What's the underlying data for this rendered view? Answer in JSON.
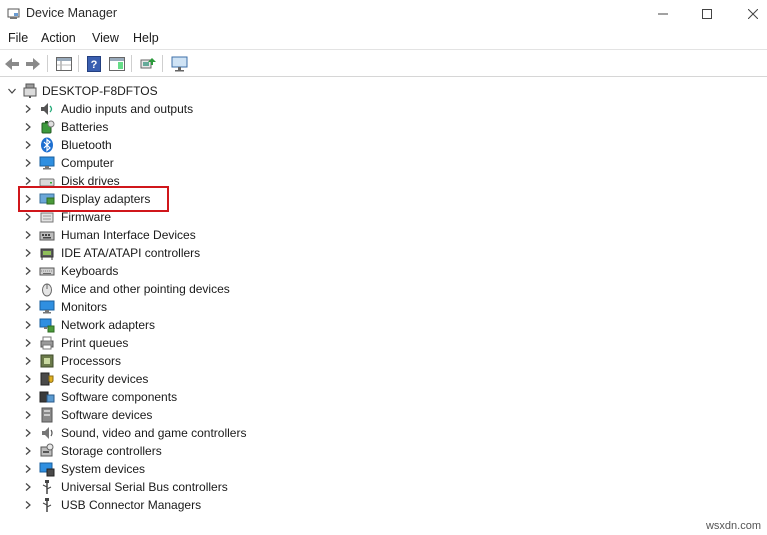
{
  "window": {
    "title": "Device Manager"
  },
  "menu": [
    "File",
    "Action",
    "View",
    "Help"
  ],
  "toolbar": {
    "buttons": [
      "back-icon",
      "forward-icon",
      "properties-grid-icon",
      "help-icon",
      "view-panel-icon",
      "update-driver-icon",
      "monitor-icon"
    ]
  },
  "tree": {
    "root": "DESKTOP-F8DFTOS",
    "categories": [
      {
        "label": "Audio inputs and outputs",
        "icon": "speaker-icon"
      },
      {
        "label": "Batteries",
        "icon": "battery-icon"
      },
      {
        "label": "Bluetooth",
        "icon": "bluetooth-icon"
      },
      {
        "label": "Computer",
        "icon": "computer-icon"
      },
      {
        "label": "Disk drives",
        "icon": "disk-drive-icon"
      },
      {
        "label": "Display adapters",
        "icon": "display-adapter-icon"
      },
      {
        "label": "Firmware",
        "icon": "firmware-icon"
      },
      {
        "label": "Human Interface Devices",
        "icon": "hid-icon"
      },
      {
        "label": "IDE ATA/ATAPI controllers",
        "icon": "ide-controller-icon"
      },
      {
        "label": "Keyboards",
        "icon": "keyboard-icon"
      },
      {
        "label": "Mice and other pointing devices",
        "icon": "mouse-icon"
      },
      {
        "label": "Monitors",
        "icon": "monitor-icon"
      },
      {
        "label": "Network adapters",
        "icon": "network-adapter-icon"
      },
      {
        "label": "Print queues",
        "icon": "printer-icon"
      },
      {
        "label": "Processors",
        "icon": "processor-icon"
      },
      {
        "label": "Security devices",
        "icon": "security-device-icon"
      },
      {
        "label": "Software components",
        "icon": "software-component-icon"
      },
      {
        "label": "Software devices",
        "icon": "software-device-icon"
      },
      {
        "label": "Sound, video and game controllers",
        "icon": "sound-controller-icon"
      },
      {
        "label": "Storage controllers",
        "icon": "storage-controller-icon"
      },
      {
        "label": "System devices",
        "icon": "system-devices-icon"
      },
      {
        "label": "Universal Serial Bus controllers",
        "icon": "usb-icon"
      },
      {
        "label": "USB Connector Managers",
        "icon": "usb-connector-icon"
      }
    ],
    "highlighted": "Display adapters"
  },
  "watermark": "wsxdn.com",
  "colors": {
    "highlight_border": "#d0161b"
  }
}
